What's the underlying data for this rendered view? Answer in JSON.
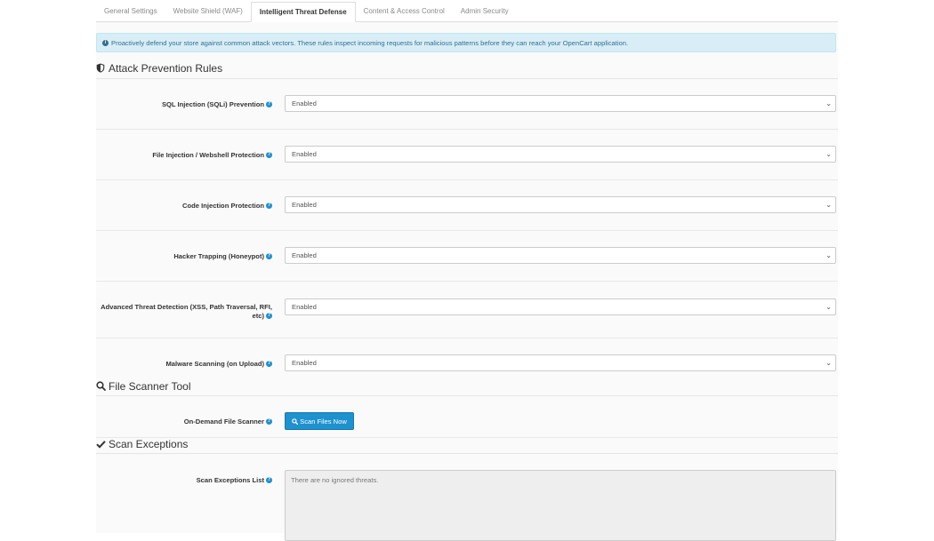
{
  "tabs": [
    {
      "label": "General Settings"
    },
    {
      "label": "Website Shield (WAF)"
    },
    {
      "label": "Intelligent Threat Defense"
    },
    {
      "label": "Content & Access Control"
    },
    {
      "label": "Admin Security"
    }
  ],
  "alert": {
    "icon": "info-circle-icon",
    "text": "Proactively defend your store against common attack vectors. These rules inspect incoming requests for malicious patterns before they can reach your OpenCart application."
  },
  "attack_section": {
    "title": "Attack Prevention Rules",
    "icon": "shield-icon",
    "rules": [
      {
        "label": "SQL Injection (SQLi) Prevention",
        "value": "Enabled"
      },
      {
        "label": "File Injection / Webshell Protection",
        "value": "Enabled"
      },
      {
        "label": "Code Injection Protection",
        "value": "Enabled"
      },
      {
        "label": "Hacker Trapping (Honeypot)",
        "value": "Enabled"
      },
      {
        "label_line1": "Advanced Threat Detection (XSS, Path Traversal, RFI,",
        "label_line2": "etc)",
        "value": "Enabled"
      },
      {
        "label": "Malware Scanning (on Upload)",
        "value": "Enabled"
      }
    ]
  },
  "scanner_section": {
    "title": "File Scanner Tool",
    "icon": "search-icon",
    "label": "On-Demand File Scanner",
    "button": "Scan Files Now"
  },
  "exceptions_section": {
    "title": "Scan Exceptions",
    "icon": "check-icon",
    "label": "Scan Exceptions List",
    "placeholder": "There are no ignored threats."
  },
  "colors": {
    "primary": "#1e91cf",
    "alert_bg": "#d9edf7",
    "alert_text": "#31708f"
  }
}
